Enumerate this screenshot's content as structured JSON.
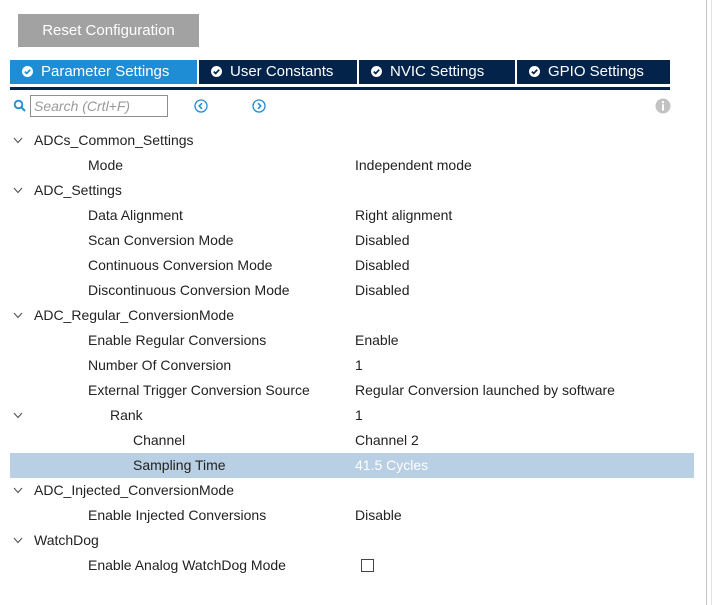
{
  "toolbar": {
    "reset_label": "Reset Configuration",
    "search_placeholder": "Search (Crtl+F)"
  },
  "tabs": [
    {
      "label": "Parameter Settings",
      "active": true
    },
    {
      "label": "User Constants",
      "active": false
    },
    {
      "label": "NVIC Settings",
      "active": false
    },
    {
      "label": "GPIO Settings",
      "active": false
    }
  ],
  "colors": {
    "active_tab": "#1f8dd6",
    "tab": "#03234b",
    "selected_row": "#b9cfe3",
    "button": "#a2a2a2",
    "accent_icon": "#1f8dd6"
  },
  "icons": [
    "search-icon",
    "check-circle-icon",
    "chevron-left-circle-icon",
    "chevron-right-circle-icon",
    "info-icon",
    "chevron-down-icon"
  ],
  "tree": {
    "group_common": "ADCs_Common_Settings",
    "mode_label": "Mode",
    "mode_value": "Independent mode",
    "group_adc": "ADC_Settings",
    "data_alignment_label": "Data Alignment",
    "data_alignment_value": "Right alignment",
    "scan_label": "Scan Conversion Mode",
    "scan_value": "Disabled",
    "continuous_label": "Continuous Conversion Mode",
    "continuous_value": "Disabled",
    "discontinuous_label": "Discontinuous Conversion Mode",
    "discontinuous_value": "Disabled",
    "group_regular": "ADC_Regular_ConversionMode",
    "enable_regular_label": "Enable Regular Conversions",
    "enable_regular_value": "Enable",
    "num_conversion_label": "Number Of Conversion",
    "num_conversion_value": "1",
    "ext_trigger_label": "External Trigger Conversion Source",
    "ext_trigger_value": "Regular Conversion launched by software",
    "rank_label": "Rank",
    "rank_value": "1",
    "channel_label": "Channel",
    "channel_value": "Channel 2",
    "sampling_label": "Sampling Time",
    "sampling_value": "41.5 Cycles",
    "group_injected": "ADC_Injected_ConversionMode",
    "enable_injected_label": "Enable Injected Conversions",
    "enable_injected_value": "Disable",
    "group_watchdog": "WatchDog",
    "analog_watchdog_label": "Enable Analog WatchDog Mode",
    "analog_watchdog_checked": false
  }
}
